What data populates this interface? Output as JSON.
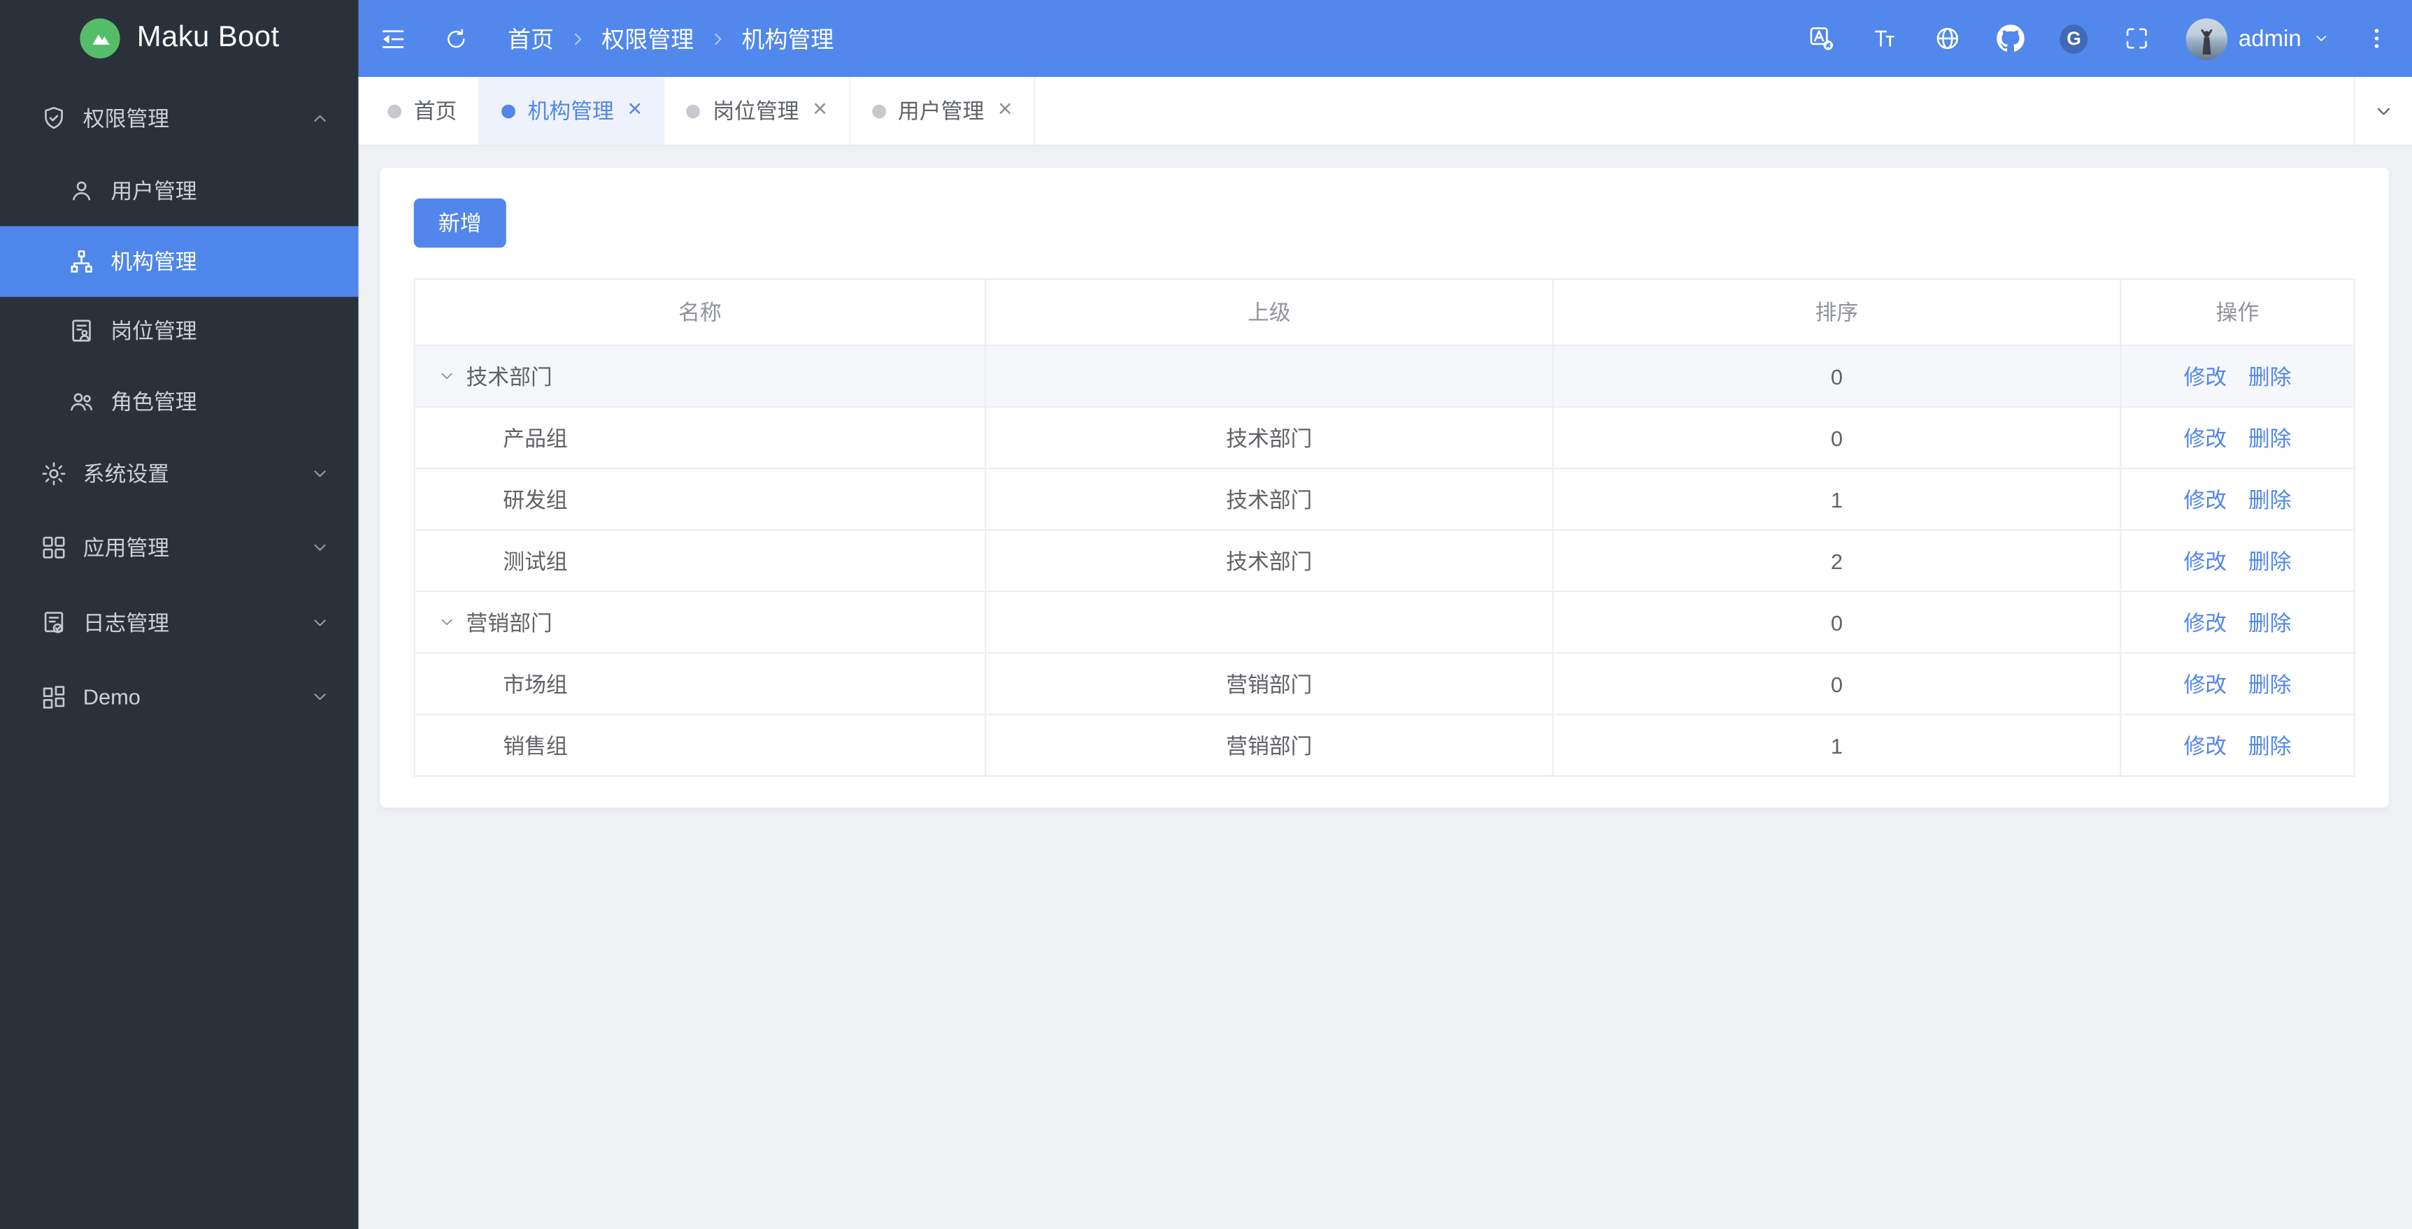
{
  "colors": {
    "accent": "#5286ec",
    "header_bg": "#5287ec",
    "sidebar_bg": "#2b313b",
    "content_bg": "#eef0f4",
    "active_tab_bg": "#edf2fd",
    "row_highlight": "#f5f7fa",
    "link": "#5286ec",
    "logo_green": "#55bd68"
  },
  "sidebar": {
    "logo_text": "Maku Boot",
    "logo_icon": "mountain-logo-icon",
    "groups": [
      {
        "label": "权限管理",
        "icon": "shield-check-icon",
        "expanded": true,
        "children": [
          {
            "label": "用户管理",
            "icon": "user-icon",
            "active": false
          },
          {
            "label": "机构管理",
            "icon": "org-icon",
            "active": true
          },
          {
            "label": "岗位管理",
            "icon": "post-icon",
            "active": false
          },
          {
            "label": "角色管理",
            "icon": "roles-icon",
            "active": false
          }
        ]
      },
      {
        "label": "系统设置",
        "icon": "gear-icon",
        "expanded": false,
        "children": []
      },
      {
        "label": "应用管理",
        "icon": "apps-icon",
        "expanded": false,
        "children": []
      },
      {
        "label": "日志管理",
        "icon": "log-icon",
        "expanded": false,
        "children": []
      },
      {
        "label": "Demo",
        "icon": "demo-icon",
        "expanded": false,
        "children": []
      }
    ]
  },
  "header": {
    "left_icons": [
      "fold-menu-icon",
      "refresh-icon"
    ],
    "breadcrumb": [
      "首页",
      "权限管理",
      "机构管理"
    ],
    "right_icons": [
      "translate-icon",
      "font-size-icon",
      "globe-icon",
      "github-icon",
      "gitee-icon",
      "fullscreen-icon"
    ],
    "user": {
      "name": "admin"
    }
  },
  "tabs": {
    "items": [
      {
        "label": "首页",
        "active": false,
        "closable": false
      },
      {
        "label": "机构管理",
        "active": true,
        "closable": true
      },
      {
        "label": "岗位管理",
        "active": false,
        "closable": true
      },
      {
        "label": "用户管理",
        "active": false,
        "closable": true
      }
    ]
  },
  "main": {
    "add_button_label": "新增",
    "table": {
      "columns": [
        "名称",
        "上级",
        "排序",
        "操作"
      ],
      "action_labels": {
        "edit": "修改",
        "delete": "删除"
      },
      "rows": [
        {
          "name": "技术部门",
          "parent": "",
          "sort": "0",
          "level": 0,
          "expandable": true,
          "highlighted": true
        },
        {
          "name": "产品组",
          "parent": "技术部门",
          "sort": "0",
          "level": 1,
          "expandable": false,
          "highlighted": false
        },
        {
          "name": "研发组",
          "parent": "技术部门",
          "sort": "1",
          "level": 1,
          "expandable": false,
          "highlighted": false
        },
        {
          "name": "测试组",
          "parent": "技术部门",
          "sort": "2",
          "level": 1,
          "expandable": false,
          "highlighted": false
        },
        {
          "name": "营销部门",
          "parent": "",
          "sort": "0",
          "level": 0,
          "expandable": true,
          "highlighted": false
        },
        {
          "name": "市场组",
          "parent": "营销部门",
          "sort": "0",
          "level": 1,
          "expandable": false,
          "highlighted": false
        },
        {
          "name": "销售组",
          "parent": "营销部门",
          "sort": "1",
          "level": 1,
          "expandable": false,
          "highlighted": false
        }
      ]
    }
  }
}
